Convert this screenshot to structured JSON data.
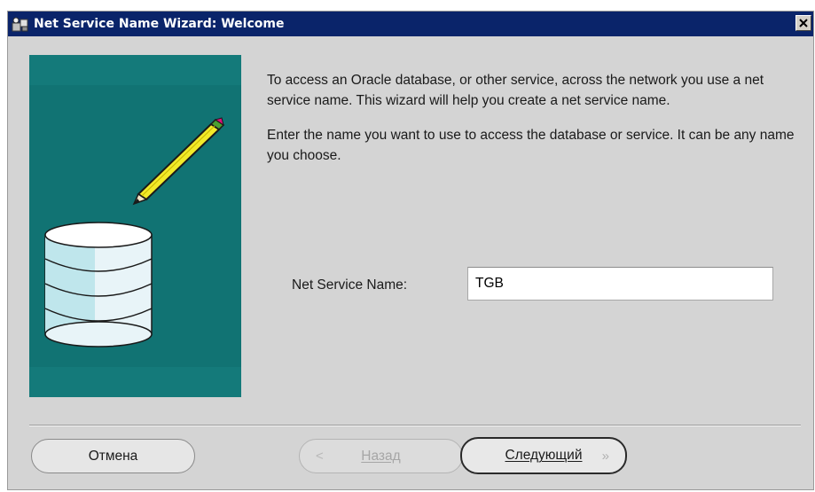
{
  "window": {
    "title": "Net Service Name Wizard: Welcome"
  },
  "intro": {
    "paragraph1": "To access an Oracle database, or other service, across the network you use a net service name.  This wizard will help you create a net service name.",
    "paragraph2": "Enter the name you want to use to access the database or service.  It can be any name you choose."
  },
  "form": {
    "net_service_name_label": "Net Service Name:",
    "net_service_name_value": "TGB"
  },
  "buttons": {
    "cancel": "Отмена",
    "back": "Назад",
    "back_chevron": "<",
    "next": "Следующий",
    "next_chevron": "»"
  },
  "colors": {
    "titlebar": "#0a246a",
    "illustration_bg": "#147a7a",
    "dialog_bg": "#d4d4d4"
  },
  "icons": {
    "title": "wizard-app-icon",
    "close": "close-icon",
    "illustration": "database-pencil-illustration"
  }
}
